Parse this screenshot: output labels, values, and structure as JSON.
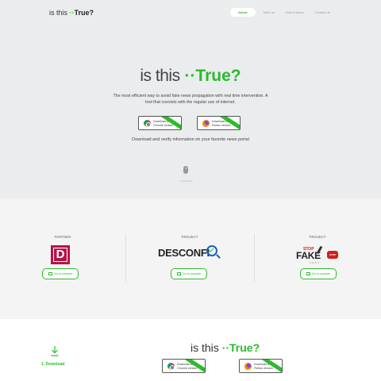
{
  "brand": {
    "prefix": "is this",
    "dots": "··",
    "suffix": "True?"
  },
  "nav": {
    "items": [
      "About",
      "Meet us",
      "How it works",
      "Contact us"
    ],
    "active": "About"
  },
  "hero": {
    "tagline": "The most efficient way to avoid fake news propagation with real time intervention. A tool that coexists with the regular use of internet.",
    "download_chrome": "Download for\nChrome version",
    "download_firefox": "Download for\nFirefox version",
    "subtitle": "Download and verify information on your favorite news portal",
    "scroll_label": "scroll down"
  },
  "partners": [
    {
      "category": "PARTNER",
      "logo_text": "D",
      "button": "Go to website"
    },
    {
      "category": "PROJECT",
      "logo_text": "DESCONFI",
      "button": "Go to website"
    },
    {
      "category": "PROJECT",
      "logo_text": "FAKE",
      "logo_stop": "STOP",
      "logo_sign": "STOP",
      "logo_sub": "NEWS",
      "button": "Go to website"
    }
  ],
  "steps": {
    "step1": "1. Download"
  },
  "colors": {
    "accent": "#2bbb2b",
    "hero_bg": "#ebecee",
    "partners_bg": "#f4f4f4",
    "partner_d": "#b7124c"
  }
}
